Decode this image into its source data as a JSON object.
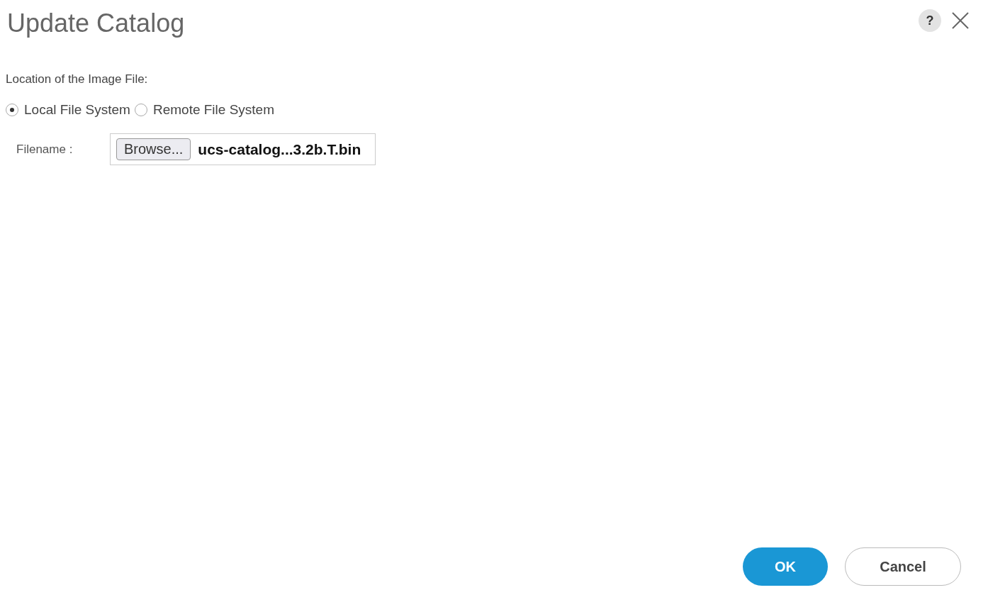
{
  "dialog": {
    "title": "Update Catalog",
    "help": "?"
  },
  "location": {
    "label": "Location of the Image File:",
    "options": [
      {
        "label": "Local File System",
        "selected": true
      },
      {
        "label": "Remote File System",
        "selected": false
      }
    ]
  },
  "filename": {
    "label": "Filename :",
    "browse": "Browse...",
    "value": "ucs-catalog...3.2b.T.bin"
  },
  "buttons": [
    {
      "label": "OK",
      "kind": "primary"
    },
    {
      "label": "Cancel",
      "kind": "secondary"
    }
  ]
}
